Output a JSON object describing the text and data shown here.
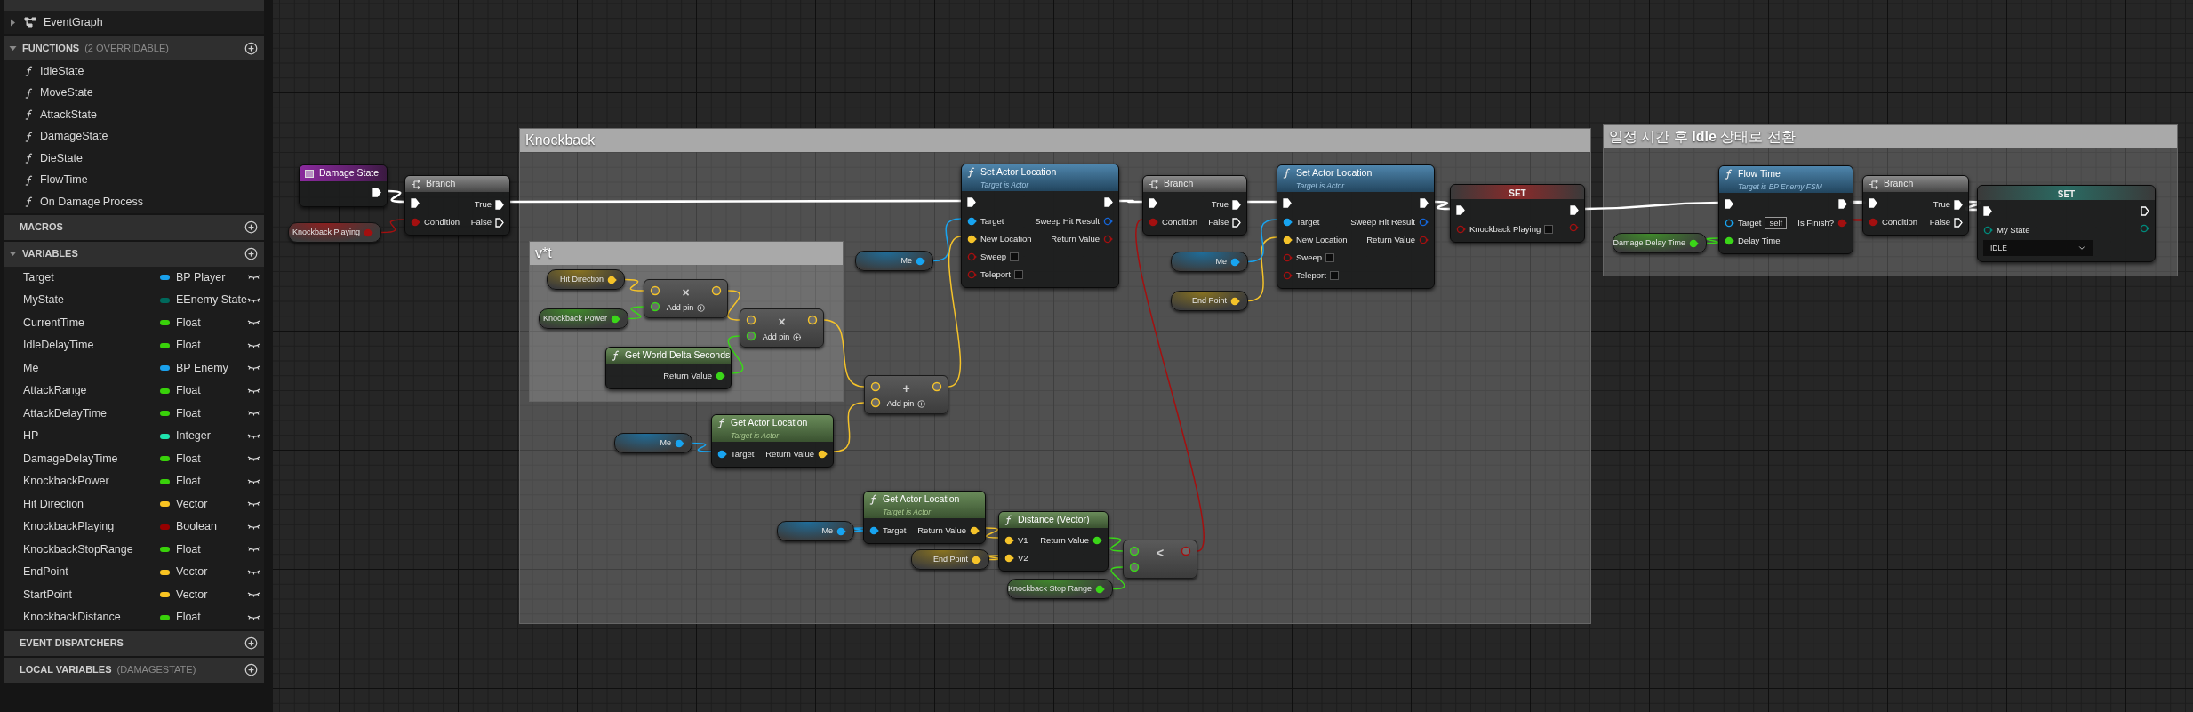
{
  "sidebar": {
    "graphs": [
      {
        "label": "EventGraph",
        "expanded": false
      }
    ],
    "sections": [
      {
        "title": "FUNCTIONS",
        "note": "(2 OVERRIDABLE)",
        "expanded": true,
        "kind": "functions",
        "items": [
          {
            "name": "IdleState"
          },
          {
            "name": "MoveState"
          },
          {
            "name": "AttackState"
          },
          {
            "name": "DamageState"
          },
          {
            "name": "DieState"
          },
          {
            "name": "FlowTime"
          },
          {
            "name": "On Damage Process"
          }
        ]
      },
      {
        "title": "MACROS"
      },
      {
        "title": "VARIABLES",
        "expanded": true,
        "kind": "variables",
        "items": [
          {
            "name": "Target",
            "type": "BP Player",
            "color": "#1aa0ec"
          },
          {
            "name": "MyState",
            "type": "EEnemy State",
            "color": "#00695c"
          },
          {
            "name": "CurrentTime",
            "type": "Float",
            "color": "#39d10a"
          },
          {
            "name": "IdleDelayTime",
            "type": "Float",
            "color": "#39d10a"
          },
          {
            "name": "Me",
            "type": "BP Enemy",
            "color": "#1aa0ec"
          },
          {
            "name": "AttackRange",
            "type": "Float",
            "color": "#39d10a"
          },
          {
            "name": "AttackDelayTime",
            "type": "Float",
            "color": "#39d10a"
          },
          {
            "name": "HP",
            "type": "Integer",
            "color": "#1fe3ad"
          },
          {
            "name": "DamageDelayTime",
            "type": "Float",
            "color": "#39d10a"
          },
          {
            "name": "KnockbackPower",
            "type": "Float",
            "color": "#39d10a"
          },
          {
            "name": "Hit Direction",
            "type": "Vector",
            "color": "#f9c422"
          },
          {
            "name": "KnockbackPlaying",
            "type": "Boolean",
            "color": "#950000"
          },
          {
            "name": "KnockbackStopRange",
            "type": "Float",
            "color": "#39d10a"
          },
          {
            "name": "EndPoint",
            "type": "Vector",
            "color": "#f9c422"
          },
          {
            "name": "StartPoint",
            "type": "Vector",
            "color": "#f9c422"
          },
          {
            "name": "KnockbackDistance",
            "type": "Float",
            "color": "#39d10a"
          }
        ]
      },
      {
        "title": "EVENT DISPATCHERS"
      },
      {
        "title": "LOCAL VARIABLES",
        "note": "(DAMAGESTATE)"
      }
    ]
  },
  "graph": {
    "comments": [
      {
        "title": "Knockback"
      },
      {
        "title": "v*t"
      },
      {
        "title": "일정 시간 후 **Idle** 상태로 전환"
      }
    ],
    "nodes": [
      {
        "kind": "event",
        "title": "Damage State",
        "rows": [
          {
            "right": {
              "kind": "exec",
              "linked": true
            }
          }
        ]
      },
      {
        "kind": "variable",
        "label": "Knockback Playing",
        "pin": {
          "kind": "bool",
          "linked": true
        }
      },
      {
        "kind": "branch",
        "title": "Branch",
        "rows": [
          {
            "left": {
              "kind": "exec",
              "linked": true
            },
            "right": {
              "label": "True",
              "kind": "exec",
              "linked": true
            }
          },
          {
            "left": {
              "label": "Condition",
              "kind": "bool",
              "linked": true
            },
            "right": {
              "label": "False",
              "kind": "exec",
              "linked": false
            }
          }
        ]
      },
      {
        "kind": "variable",
        "label": "Hit Direction",
        "pin": {
          "kind": "vector",
          "linked": true
        }
      },
      {
        "kind": "variable",
        "label": "Knockback Power",
        "pin": {
          "kind": "float",
          "linked": true
        }
      },
      {
        "kind": "math",
        "symbol": "×",
        "add_pin": "Add pin",
        "inputs": [
          {
            "kind": "vector"
          },
          {
            "kind": "float"
          }
        ],
        "output": {
          "kind": "vector"
        }
      },
      {
        "kind": "math",
        "symbol": "×",
        "add_pin": "Add pin",
        "inputs": [
          {
            "kind": "vector"
          },
          {
            "kind": "float"
          }
        ],
        "output": {
          "kind": "vector"
        }
      },
      {
        "kind": "function",
        "pure": true,
        "title": "Get World Delta Seconds",
        "rows": [
          {
            "right": {
              "label": "Return Value",
              "kind": "float",
              "linked": true
            }
          }
        ]
      },
      {
        "kind": "math",
        "symbol": "+",
        "add_pin": "Add pin",
        "inputs": [
          {
            "kind": "vector"
          },
          {
            "kind": "vector"
          }
        ],
        "output": {
          "kind": "vector"
        }
      },
      {
        "kind": "variable",
        "label": "Me",
        "pin": {
          "kind": "object",
          "linked": true
        }
      },
      {
        "kind": "function",
        "pure": true,
        "title": "Get Actor Location",
        "subtitle": "Target is Actor",
        "rows": [
          {
            "left": {
              "label": "Target",
              "kind": "object",
              "linked": true
            },
            "right": {
              "label": "Return Value",
              "kind": "vector",
              "linked": true
            }
          }
        ]
      },
      {
        "kind": "variable",
        "label": "Me",
        "pin": {
          "kind": "object",
          "linked": true
        }
      },
      {
        "kind": "function",
        "pure": false,
        "title": "Set Actor Location",
        "subtitle": "Target is Actor",
        "rows": [
          {
            "left": {
              "kind": "exec",
              "linked": true
            },
            "right": {
              "kind": "exec",
              "linked": true
            }
          },
          {
            "left": {
              "label": "Target",
              "kind": "object",
              "linked": true
            },
            "right": {
              "label": "Sweep Hit Result",
              "kind": "struct",
              "linked": false
            }
          },
          {
            "left": {
              "label": "New Location",
              "kind": "vector",
              "linked": true
            },
            "right": {
              "label": "Return Value",
              "kind": "bool",
              "linked": false
            }
          },
          {
            "left": {
              "label": "Sweep",
              "kind": "bool",
              "linked": false,
              "checked": false
            }
          },
          {
            "left": {
              "label": "Teleport",
              "kind": "bool",
              "linked": false,
              "checked": false
            }
          }
        ]
      },
      {
        "kind": "branch",
        "title": "Branch",
        "rows": [
          {
            "left": {
              "kind": "exec",
              "linked": true
            },
            "right": {
              "label": "True",
              "kind": "exec",
              "linked": true
            }
          },
          {
            "left": {
              "label": "Condition",
              "kind": "bool",
              "linked": true
            },
            "right": {
              "label": "False",
              "kind": "exec",
              "linked": false
            }
          }
        ]
      },
      {
        "kind": "variable",
        "label": "Me",
        "pin": {
          "kind": "object",
          "linked": true
        }
      },
      {
        "kind": "variable",
        "label": "End Point",
        "pin": {
          "kind": "vector",
          "linked": true
        }
      },
      {
        "kind": "function",
        "pure": false,
        "title": "Set Actor Location",
        "subtitle": "Target is Actor",
        "rows": [
          {
            "left": {
              "kind": "exec",
              "linked": true
            },
            "right": {
              "kind": "exec",
              "linked": true
            }
          },
          {
            "left": {
              "label": "Target",
              "kind": "object",
              "linked": true
            },
            "right": {
              "label": "Sweep Hit Result",
              "kind": "struct",
              "linked": false
            }
          },
          {
            "left": {
              "label": "New Location",
              "kind": "vector",
              "linked": true
            },
            "right": {
              "label": "Return Value",
              "kind": "bool",
              "linked": false
            }
          },
          {
            "left": {
              "label": "Sweep",
              "kind": "bool",
              "linked": false,
              "checked": false
            }
          },
          {
            "left": {
              "label": "Teleport",
              "kind": "bool",
              "linked": false,
              "checked": false
            }
          }
        ]
      },
      {
        "kind": "set",
        "title": "SET",
        "rows": [
          {
            "left": {
              "kind": "exec",
              "linked": true
            },
            "right": {
              "kind": "exec",
              "linked": true
            }
          },
          {
            "left": {
              "label": "Knockback Playing",
              "kind": "bool",
              "linked": false,
              "checked": false
            },
            "right": {
              "kind": "bool",
              "linked": false
            }
          }
        ]
      },
      {
        "kind": "variable",
        "label": "Me",
        "pin": {
          "kind": "object",
          "linked": true
        }
      },
      {
        "kind": "function",
        "pure": true,
        "title": "Get Actor Location",
        "subtitle": "Target is Actor",
        "rows": [
          {
            "left": {
              "label": "Target",
              "kind": "object",
              "linked": true
            },
            "right": {
              "label": "Return Value",
              "kind": "vector",
              "linked": true
            }
          }
        ]
      },
      {
        "kind": "variable",
        "label": "End Point",
        "pin": {
          "kind": "vector",
          "linked": true
        }
      },
      {
        "kind": "function",
        "pure": true,
        "title": "Distance (Vector)",
        "rows": [
          {
            "left": {
              "label": "V1",
              "kind": "vector",
              "linked": true
            },
            "right": {
              "label": "Return Value",
              "kind": "float",
              "linked": true
            }
          },
          {
            "left": {
              "label": "V2",
              "kind": "vector",
              "linked": true
            }
          }
        ]
      },
      {
        "kind": "math",
        "symbol": "<",
        "inputs": [
          {
            "kind": "float"
          },
          {
            "kind": "float"
          }
        ],
        "output": {
          "kind": "bool"
        }
      },
      {
        "kind": "variable",
        "label": "Knockback Stop Range",
        "pin": {
          "kind": "float",
          "linked": true
        }
      },
      {
        "kind": "variable",
        "label": "Damage Delay Time",
        "pin": {
          "kind": "float",
          "linked": true
        }
      },
      {
        "kind": "function",
        "pure": false,
        "title": "Flow Time",
        "subtitle": "Target is BP Enemy FSM",
        "rows": [
          {
            "left": {
              "kind": "exec",
              "linked": true
            },
            "right": {
              "kind": "exec",
              "linked": true
            }
          },
          {
            "left": {
              "label": "Target",
              "kind": "object",
              "linked": false,
              "value": "self"
            },
            "right": {
              "label": "Is Finish?",
              "kind": "bool",
              "linked": true
            }
          },
          {
            "left": {
              "label": "Delay Time",
              "kind": "float",
              "linked": true
            }
          }
        ]
      },
      {
        "kind": "branch",
        "title": "Branch",
        "rows": [
          {
            "left": {
              "kind": "exec",
              "linked": true
            },
            "right": {
              "label": "True",
              "kind": "exec",
              "linked": true
            }
          },
          {
            "left": {
              "label": "Condition",
              "kind": "bool",
              "linked": true
            },
            "right": {
              "label": "False",
              "kind": "exec",
              "linked": false
            }
          }
        ]
      },
      {
        "kind": "set",
        "title": "SET",
        "rows": [
          {
            "left": {
              "kind": "exec",
              "linked": true
            },
            "right": {
              "kind": "exec",
              "linked": false
            }
          },
          {
            "left": {
              "label": "My State",
              "kind": "enum",
              "linked": false,
              "dropdown": "IDLE"
            },
            "right": {
              "kind": "enum",
              "linked": false
            }
          }
        ]
      }
    ]
  }
}
